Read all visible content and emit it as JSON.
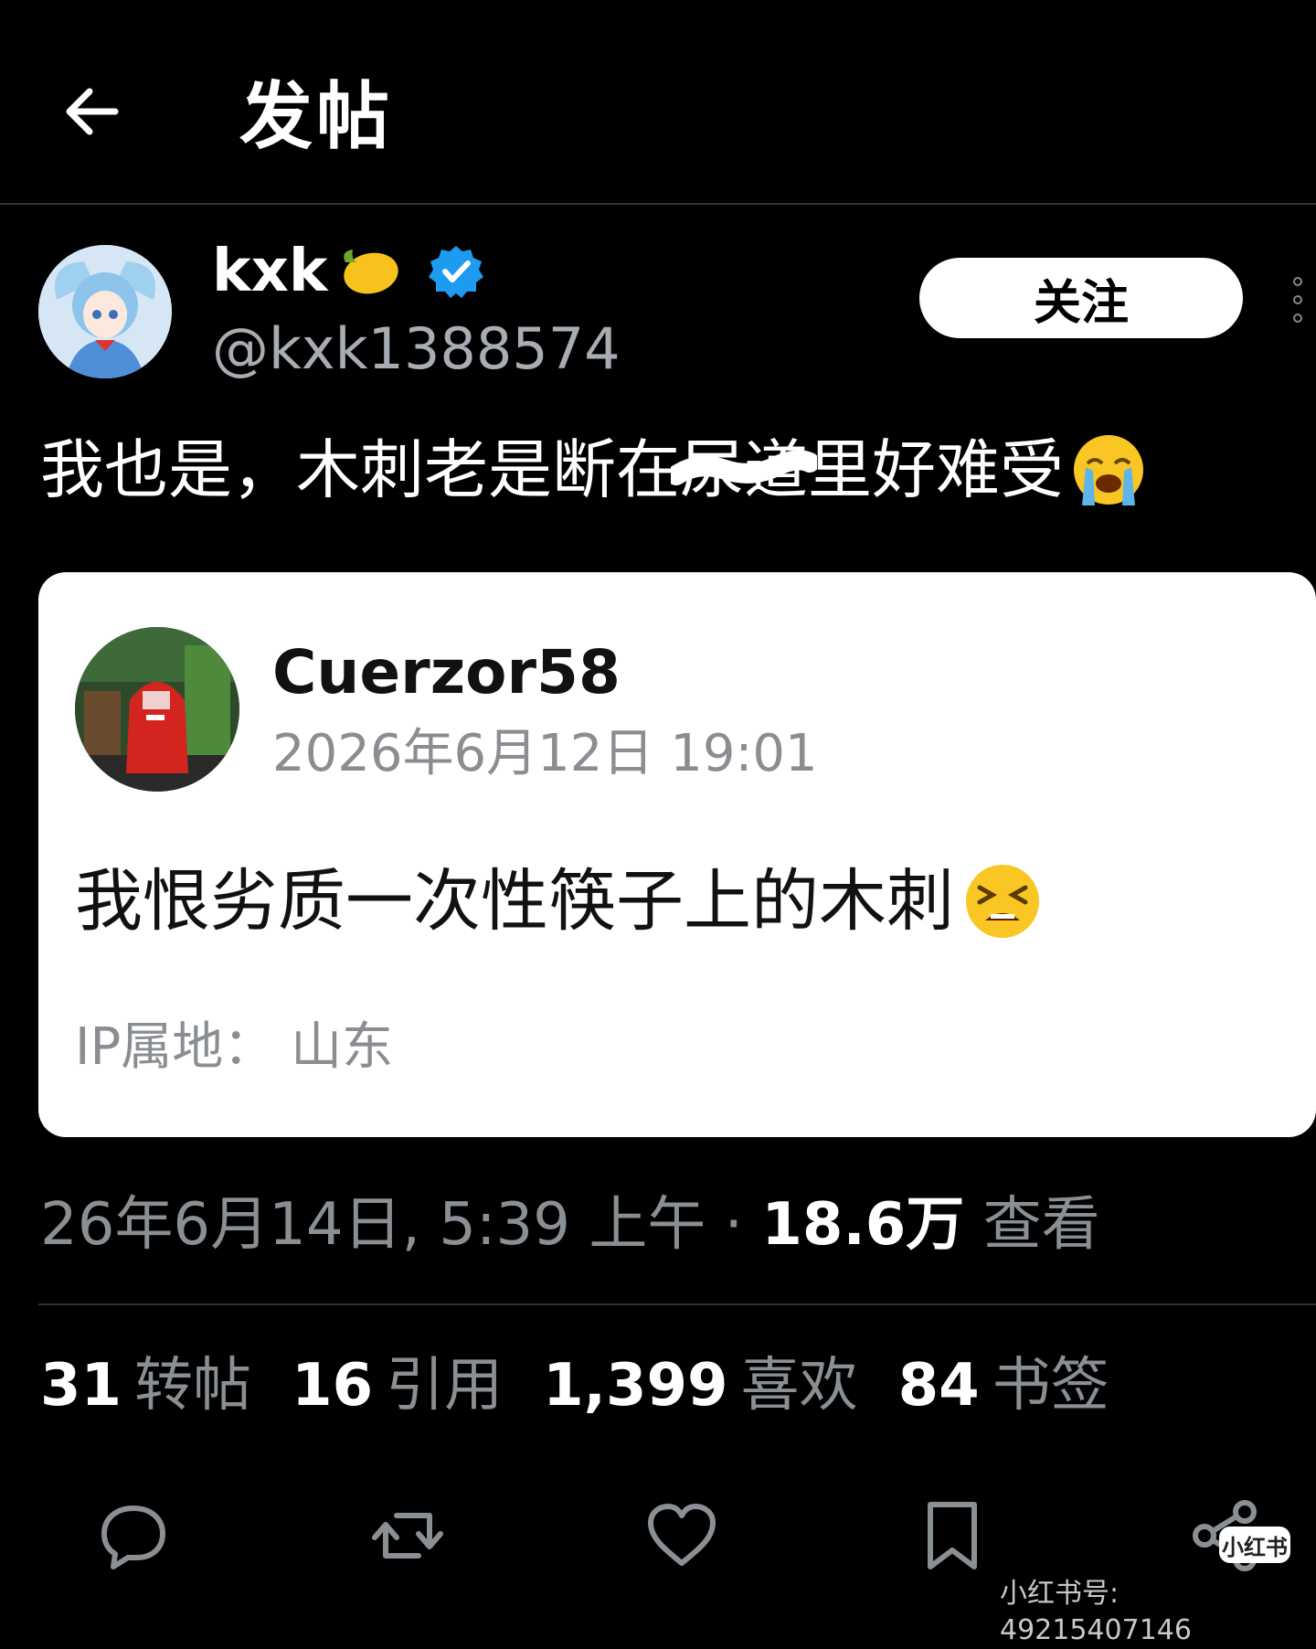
{
  "header": {
    "title": "发帖",
    "back_icon": "arrow-left-icon"
  },
  "author": {
    "name": "kxk",
    "name_emoji": "lemon-icon",
    "verified_icon": "verified-badge-icon",
    "handle": "@kxk1388574",
    "follow_label": "关注",
    "more_icon": "more-vertical-icon"
  },
  "post": {
    "text_before": "我也是，木刺老是断在",
    "text_scribbled": "尿道",
    "text_after": "里好难受",
    "emoji": "loudly-crying-face-icon"
  },
  "quote": {
    "name": "Cuerzor58",
    "time": "2026年6月12日 19:01",
    "text": "我恨劣质一次性筷子上的木刺",
    "emoji": "tired-face-icon",
    "ip": "IP属地： 山东"
  },
  "meta": {
    "datetime": "26年6月14日, 5:39 上午 · ",
    "views_value": "18.6万",
    "views_label": " 查看"
  },
  "stats": [
    {
      "value": "31",
      "label": "转帖"
    },
    {
      "value": "16",
      "label": "引用"
    },
    {
      "value": "1,399",
      "label": "喜欢"
    },
    {
      "value": "84",
      "label": "书签"
    }
  ],
  "actions": [
    "reply-icon",
    "retweet-icon",
    "like-icon",
    "bookmark-icon",
    "share-icon"
  ],
  "watermark": {
    "badge": "小红书",
    "text": "小红书号: 49215407146"
  },
  "colors": {
    "background": "#000000",
    "verified": "#1d9bf0",
    "secondary_text": "#8a8f94"
  }
}
